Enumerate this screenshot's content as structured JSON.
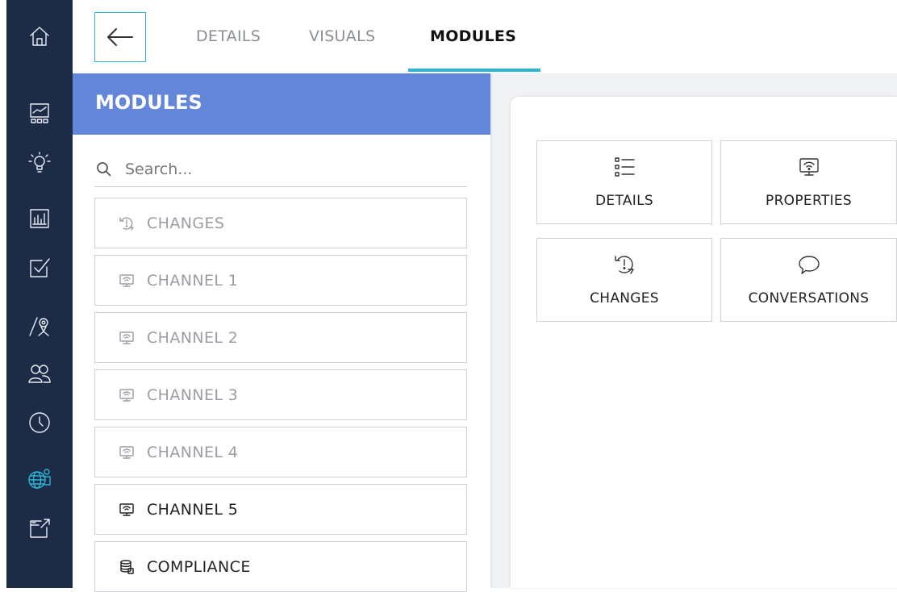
{
  "nav_rail": {
    "items": [
      {
        "icon": "home-icon"
      },
      {
        "icon": "dashboard-icon"
      },
      {
        "icon": "lightbulb-icon"
      },
      {
        "icon": "bar-chart-icon"
      },
      {
        "icon": "checkbox-icon"
      },
      {
        "icon": "location-pin-icon"
      },
      {
        "icon": "users-icon"
      },
      {
        "icon": "clock-icon"
      },
      {
        "icon": "globe-person-icon",
        "active": true
      },
      {
        "icon": "export-window-icon"
      }
    ],
    "background": "#1c2b46",
    "active_color": "#2bb4d4"
  },
  "topbar": {
    "back_icon": "arrow-left-icon",
    "tabs": [
      {
        "label": "DETAILS",
        "active": false
      },
      {
        "label": "VISUALS",
        "active": false
      },
      {
        "label": "MODULES",
        "active": true
      }
    ],
    "accent": "#2bb4d4"
  },
  "modules_panel": {
    "title": "MODULES",
    "header_color": "#6386d8",
    "search": {
      "placeholder": "Search...",
      "value": ""
    },
    "items": [
      {
        "label": "CHANGES",
        "icon": "changes-icon",
        "enabled": false
      },
      {
        "label": "CHANNEL 1",
        "icon": "channel-icon",
        "enabled": false
      },
      {
        "label": "CHANNEL 2",
        "icon": "channel-icon",
        "enabled": false
      },
      {
        "label": "CHANNEL 3",
        "icon": "channel-icon",
        "enabled": false
      },
      {
        "label": "CHANNEL 4",
        "icon": "channel-icon",
        "enabled": false
      },
      {
        "label": "CHANNEL 5",
        "icon": "channel-icon",
        "enabled": true
      },
      {
        "label": "COMPLIANCE",
        "icon": "database-icon",
        "enabled": true
      }
    ]
  },
  "canvas": {
    "tiles": [
      {
        "label": "DETAILS",
        "icon": "list-icon"
      },
      {
        "label": "PROPERTIES",
        "icon": "channel-icon"
      },
      {
        "label": "CHANGES",
        "icon": "changes-icon"
      },
      {
        "label": "CONVERSATIONS",
        "icon": "speech-bubble-icon"
      }
    ]
  }
}
